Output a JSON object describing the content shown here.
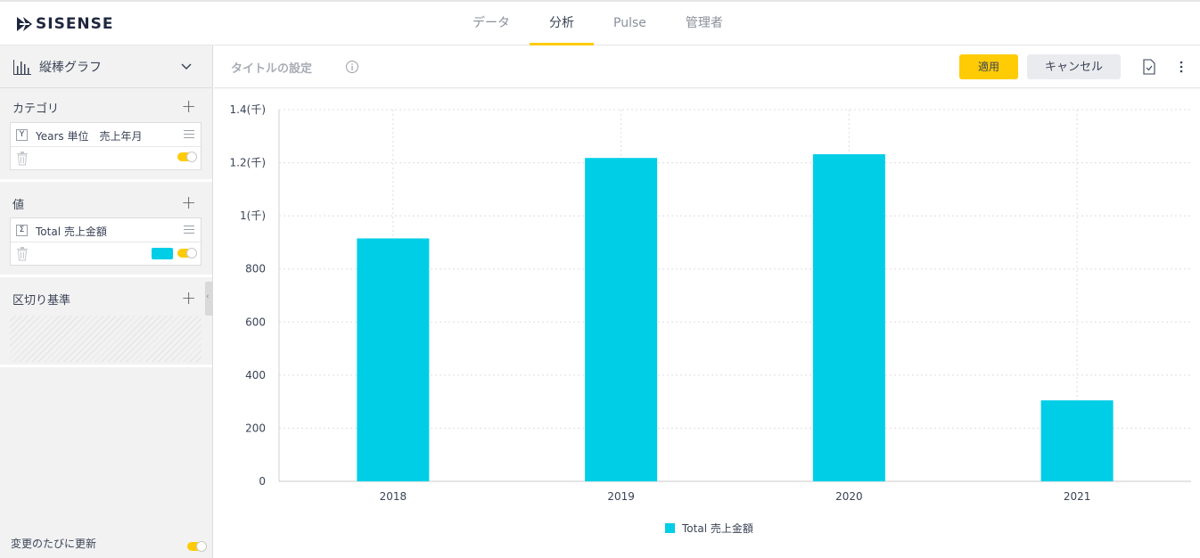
{
  "app": {
    "logo_text": "SISENSE",
    "tabs": [
      {
        "label": "データ",
        "active": false
      },
      {
        "label": "分析",
        "active": true
      },
      {
        "label": "Pulse",
        "active": false
      },
      {
        "label": "管理者",
        "active": false
      }
    ],
    "accent_color": "#ffcb05"
  },
  "left_panel": {
    "chart_type": {
      "label": "縦棒グラフ",
      "icon": "bar-chart-icon"
    },
    "sections": {
      "category": {
        "title": "カテゴリ",
        "field": {
          "badge": "Y",
          "name": "Years 単位　売上年月",
          "enabled": true
        }
      },
      "values": {
        "title": "値",
        "field": {
          "badge": "Σ",
          "name": "Total 売上金額",
          "color": "#00cee6",
          "enabled": true
        }
      },
      "break_by": {
        "title": "区切り基準"
      }
    },
    "auto_update": {
      "label": "変更のたびに更新",
      "enabled": true
    }
  },
  "title_bar": {
    "placeholder": "タイトルの設定",
    "apply_label": "適用",
    "cancel_label": "キャンセル"
  },
  "chart_data": {
    "type": "bar",
    "categories": [
      "2018",
      "2019",
      "2020",
      "2021"
    ],
    "series": [
      {
        "name": "Total 売上金額",
        "color": "#00cee6",
        "values": [
          915,
          1218,
          1232,
          305
        ]
      }
    ],
    "ylim": [
      0,
      1400
    ],
    "yticks": [
      {
        "value": 0,
        "label": "0"
      },
      {
        "value": 200,
        "label": "200"
      },
      {
        "value": 400,
        "label": "400"
      },
      {
        "value": 600,
        "label": "600"
      },
      {
        "value": 800,
        "label": "800"
      },
      {
        "value": 1000,
        "label": "1(千)"
      },
      {
        "value": 1200,
        "label": "1.2(千)"
      },
      {
        "value": 1400,
        "label": "1.4(千)"
      }
    ],
    "grid": true,
    "legend_position": "bottom-center"
  }
}
